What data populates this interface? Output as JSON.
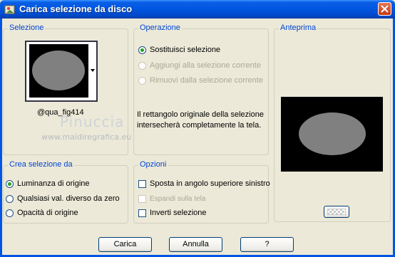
{
  "window": {
    "title": "Carica selezione da disco"
  },
  "selezione": {
    "legend": "Selezione",
    "file_name": "@qua_fig414"
  },
  "operazione": {
    "legend": "Operazione",
    "options": [
      {
        "label": "Sostituisci selezione",
        "checked": true,
        "disabled": false
      },
      {
        "label": "Aggiungi alla selezione corrente",
        "checked": false,
        "disabled": true
      },
      {
        "label": "Rimuovi dalla selezione corrente",
        "checked": false,
        "disabled": true
      }
    ],
    "description": "Il rettangolo originale della selezione intersecherà completamente la tela."
  },
  "anteprima": {
    "legend": "Anteprima"
  },
  "crea": {
    "legend": "Crea selezione da",
    "options": [
      {
        "label": "Luminanza di origine",
        "checked": true
      },
      {
        "label": "Qualsiasi val. diverso da zero",
        "checked": false
      },
      {
        "label": "Opacità di origine",
        "checked": false
      }
    ]
  },
  "opzioni": {
    "legend": "Opzioni",
    "items": [
      {
        "label": "Sposta in angolo superiore sinistro",
        "checked": false,
        "disabled": false
      },
      {
        "label": "Espandi sulla tela",
        "checked": false,
        "disabled": true
      },
      {
        "label": "Inverti selezione",
        "checked": false,
        "disabled": false
      }
    ]
  },
  "buttons": {
    "load": "Carica",
    "cancel": "Annulla",
    "help": "?"
  },
  "watermark": {
    "name": "Pinuccia",
    "url": "www.maidiregrafica.eu"
  },
  "colors": {
    "title_bar": "#0054e3",
    "legend_text": "#0046d5",
    "dialog_bg": "#ece9d8",
    "ellipse": "#808080"
  }
}
